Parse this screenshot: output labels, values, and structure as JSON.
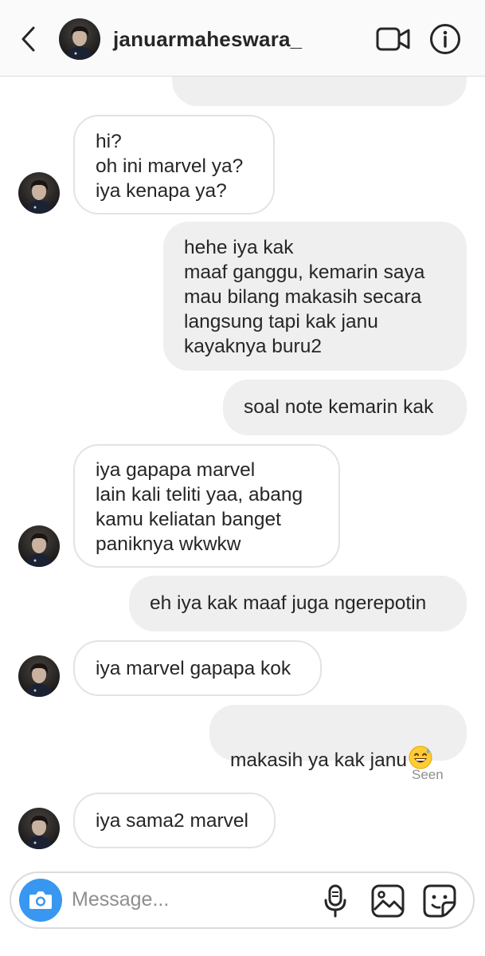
{
  "header": {
    "username": "januarmaheswara_",
    "back_icon": "chevron-left-icon",
    "video_icon": "video-camera-icon",
    "info_icon": "info-icon"
  },
  "messages": [
    {
      "direction": "outgoing",
      "text": ""
    },
    {
      "direction": "incoming",
      "text": "hi?\noh ini marvel ya?\niya kenapa ya?"
    },
    {
      "direction": "outgoing",
      "text": "hehe iya kak\nmaaf ganggu, kemarin saya\nmau bilang makasih secara\nlangsung tapi kak janu\nkayaknya buru2"
    },
    {
      "direction": "outgoing",
      "text": "soal note kemarin kak"
    },
    {
      "direction": "incoming",
      "text": "iya gapapa marvel\nlain kali teliti yaa, abang\nkamu keliatan banget\npaniknya wkwkw"
    },
    {
      "direction": "outgoing",
      "text": "eh iya kak maaf juga ngerepotin"
    },
    {
      "direction": "incoming",
      "text": "iya marvel gapapa kok"
    },
    {
      "direction": "outgoing",
      "text": "makasih ya kak janu",
      "emoji": "sweat-smile-emoji"
    },
    {
      "direction": "incoming",
      "text": "iya sama2 marvel"
    }
  ],
  "seen_label": "Seen",
  "composer": {
    "placeholder": "Message...",
    "camera_icon": "camera-icon",
    "mic_icon": "microphone-icon",
    "gallery_icon": "image-icon",
    "sticker_icon": "sticker-icon"
  },
  "colors": {
    "outgoing_bubble": "#efefef",
    "incoming_border": "#e3e3e3",
    "camera_blue": "#3897f0",
    "text": "#262626",
    "muted": "#8e8e8e"
  }
}
